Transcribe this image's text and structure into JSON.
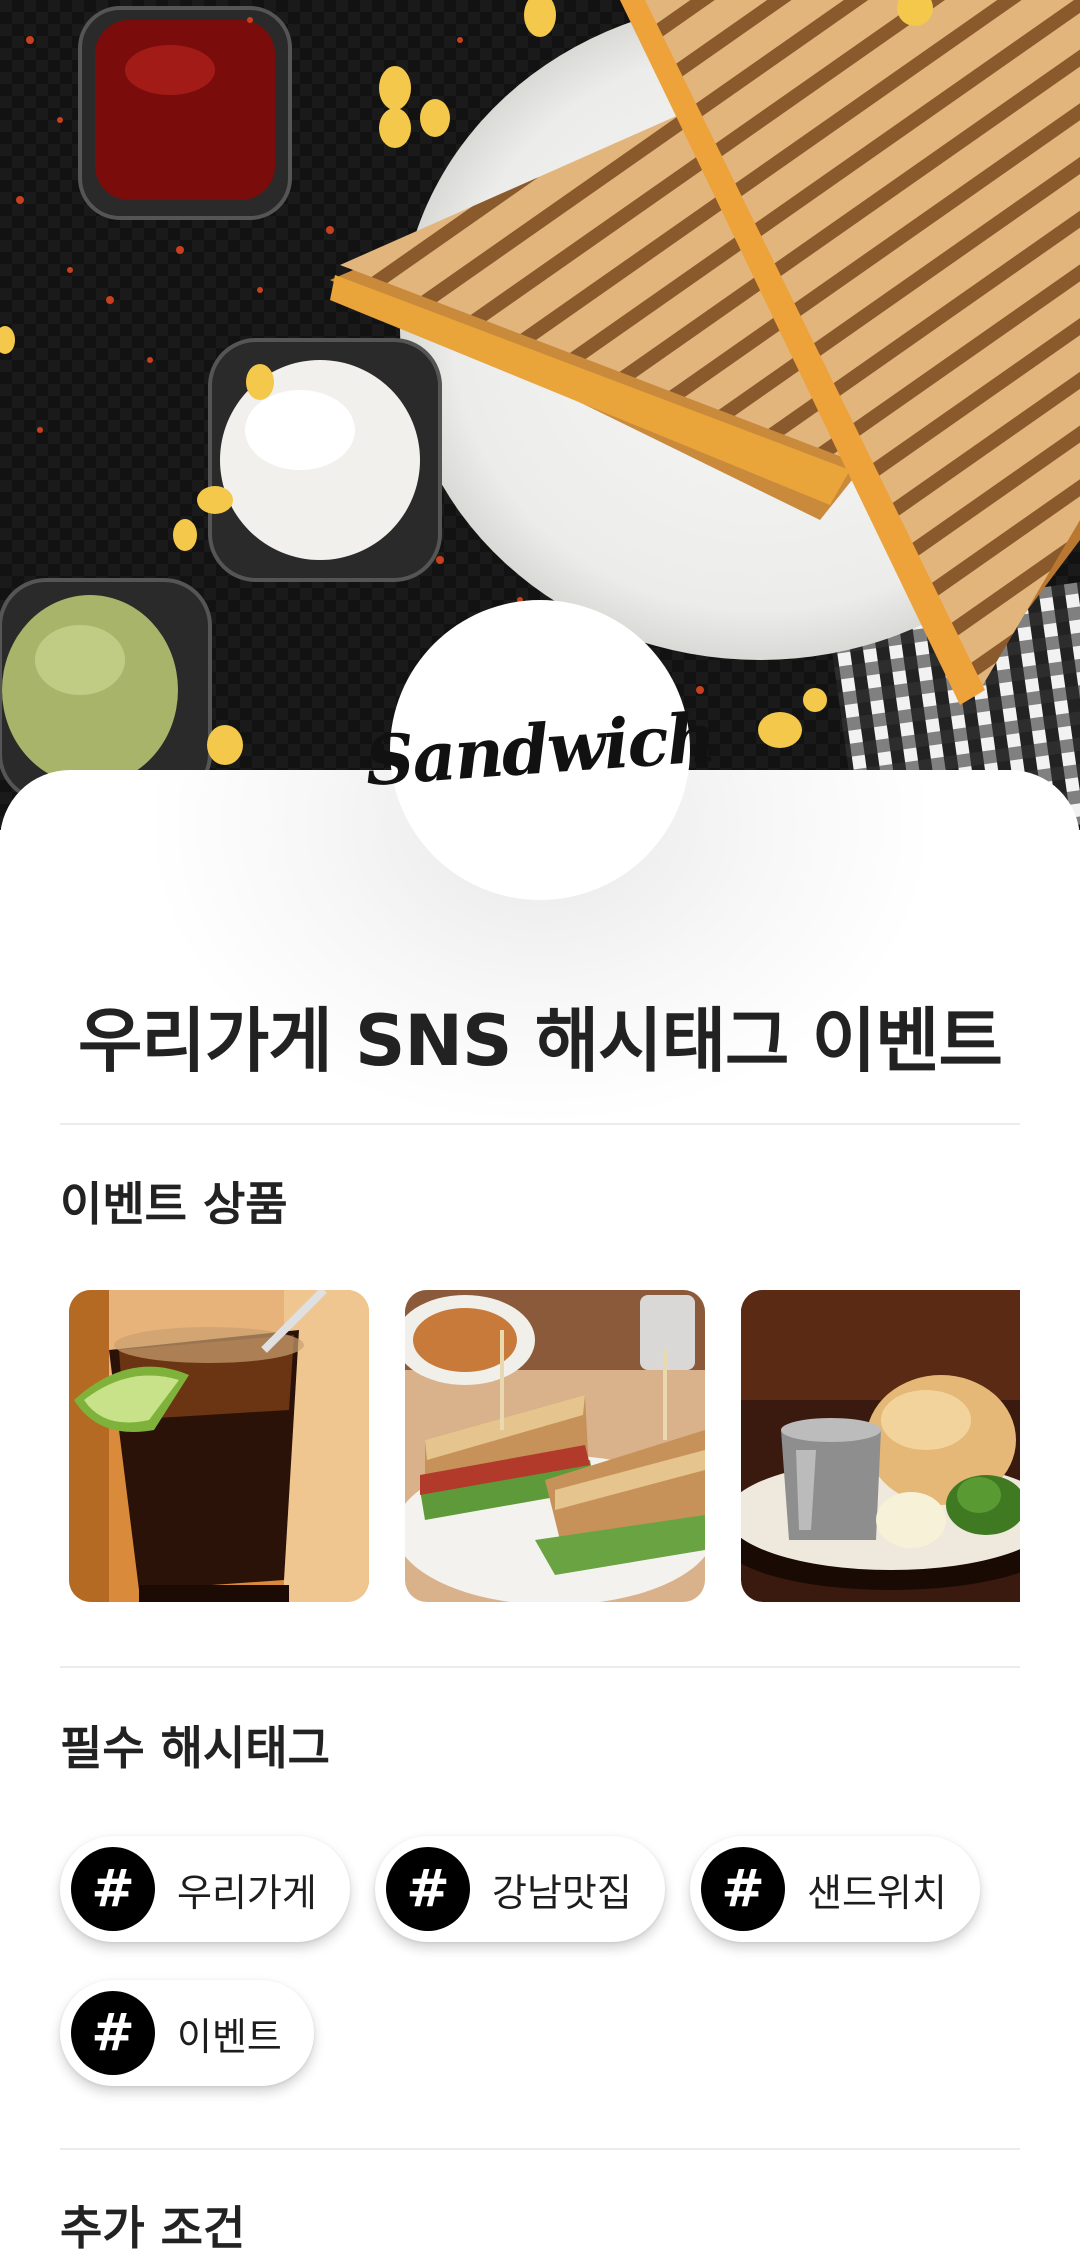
{
  "brand": {
    "logo_text": "Sandwich"
  },
  "page": {
    "title": "우리가게 SNS 해시태그 이벤트"
  },
  "sections": {
    "products": {
      "title": "이벤트 상품",
      "items": [
        {
          "image": "cola-drink-photo"
        },
        {
          "image": "club-sandwich-photo"
        },
        {
          "image": "bread-and-milk-photo"
        }
      ]
    },
    "hashtags": {
      "title": "필수 해시태그",
      "icon": "hash-icon",
      "items": [
        {
          "label": "우리가게"
        },
        {
          "label": "강남맛집"
        },
        {
          "label": "샌드위치"
        },
        {
          "label": "이벤트"
        }
      ]
    },
    "conditions": {
      "title": "추가 조건"
    }
  },
  "colors": {
    "hashtag_icon_bg": "#000000",
    "title_text": "#222222"
  }
}
